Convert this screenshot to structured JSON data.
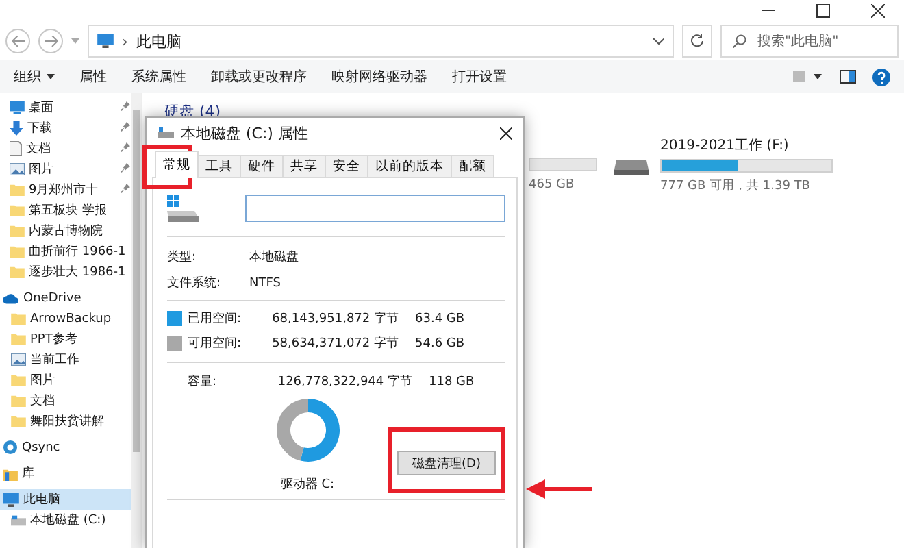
{
  "address_bar": {
    "path": "此电脑",
    "separator": "›"
  },
  "search": {
    "placeholder": "搜索\"此电脑\""
  },
  "ribbon": {
    "items": [
      {
        "label": "组织",
        "dropdown": true
      },
      {
        "label": "属性",
        "dropdown": false
      },
      {
        "label": "系统属性",
        "dropdown": false
      },
      {
        "label": "卸载或更改程序",
        "dropdown": false
      },
      {
        "label": "映射网络驱动器",
        "dropdown": false
      },
      {
        "label": "打开设置",
        "dropdown": false
      }
    ]
  },
  "sidebar": {
    "items": [
      {
        "label": "桌面",
        "kind": "desktop",
        "pinned": true,
        "selected": false
      },
      {
        "label": "下载",
        "kind": "download",
        "pinned": true,
        "selected": false
      },
      {
        "label": "文档",
        "kind": "document",
        "pinned": true,
        "selected": false
      },
      {
        "label": "图片",
        "kind": "picture",
        "pinned": true,
        "selected": false
      },
      {
        "label": "9月郑州市十",
        "kind": "folder",
        "pinned": true,
        "selected": false
      },
      {
        "label": "第五板块 学报",
        "kind": "folder",
        "pinned": false,
        "selected": false
      },
      {
        "label": "内蒙古博物院",
        "kind": "folder",
        "pinned": false,
        "selected": false
      },
      {
        "label": "曲折前行 1966-1",
        "kind": "folder",
        "pinned": false,
        "selected": false
      },
      {
        "label": "逐步壮大 1986-1",
        "kind": "folder",
        "pinned": false,
        "selected": false
      },
      {
        "label": "OneDrive",
        "kind": "cloud",
        "pinned": false,
        "selected": false,
        "children": [
          {
            "label": "ArrowBackup",
            "kind": "folder",
            "pinned": false,
            "selected": false
          },
          {
            "label": "PPT参考",
            "kind": "folder",
            "pinned": false,
            "selected": false
          },
          {
            "label": "当前工作",
            "kind": "picture",
            "pinned": false,
            "selected": false
          },
          {
            "label": "图片",
            "kind": "folder",
            "pinned": false,
            "selected": false
          },
          {
            "label": "文档",
            "kind": "folder",
            "pinned": false,
            "selected": false
          },
          {
            "label": "舞阳扶贫讲解",
            "kind": "folder",
            "pinned": false,
            "selected": false
          }
        ]
      },
      {
        "label": "Qsync",
        "kind": "sync",
        "pinned": false,
        "selected": false
      },
      {
        "label": "库",
        "kind": "library",
        "pinned": false,
        "selected": false
      },
      {
        "label": "此电脑",
        "kind": "pc",
        "pinned": false,
        "selected": true,
        "children": [
          {
            "label": "本地磁盘 (C:)",
            "kind": "drive",
            "pinned": false,
            "selected": false
          }
        ]
      }
    ]
  },
  "content": {
    "group_title": "硬盘 (4)",
    "partial_drive": {
      "caption": "465 GB"
    },
    "drive": {
      "name": "2019-2021工作 (F:)",
      "level": 0.45,
      "caption": "777 GB 可用，共 1.39 TB"
    }
  },
  "dialog": {
    "title": "本地磁盘 (C:) 属性",
    "tabs": [
      {
        "label": "常规",
        "selected": true
      },
      {
        "label": "工具",
        "selected": false
      },
      {
        "label": "硬件",
        "selected": false
      },
      {
        "label": "共享",
        "selected": false
      },
      {
        "label": "安全",
        "selected": false
      },
      {
        "label": "以前的版本",
        "selected": false
      },
      {
        "label": "配额",
        "selected": false
      }
    ],
    "info": [
      {
        "label": "类型:",
        "value": "本地磁盘"
      },
      {
        "label": "文件系统:",
        "value": "NTFS"
      }
    ],
    "space": [
      {
        "label": "已用空间:",
        "bytes": "68,143,951,872 字节",
        "size": "63.4 GB",
        "color": "#1f9ae0"
      },
      {
        "label": "可用空间:",
        "bytes": "58,634,371,072 字节",
        "size": "54.6 GB",
        "color": "#a8a8a8"
      }
    ],
    "capacity": {
      "label": "容量:",
      "bytes": "126,778,322,944 字节",
      "size": "118 GB",
      "level": 0.54
    },
    "drive_label": "驱动器 C:",
    "cleanup_button": "磁盘清理(D)"
  }
}
